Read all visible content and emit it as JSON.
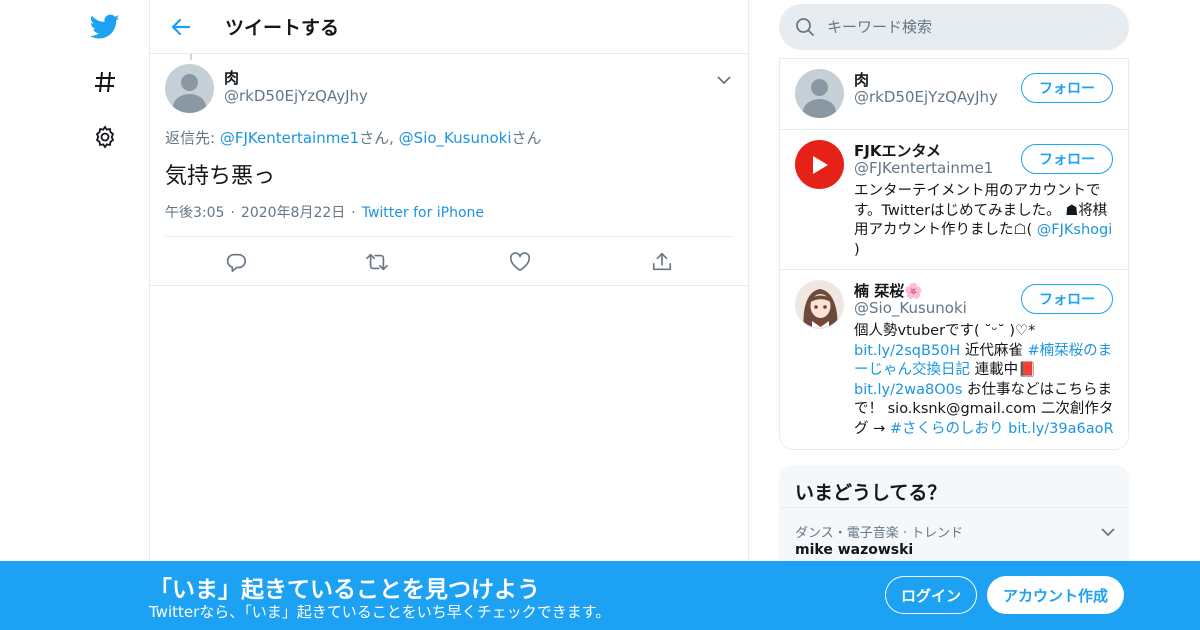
{
  "colors": {
    "accent": "#1da1f2",
    "link": "#1b95e0",
    "muted": "#657786",
    "youtube_red": "#e62117"
  },
  "leftnav": {
    "icons": [
      "twitter-bird-icon",
      "hashtag-icon",
      "gear-icon"
    ]
  },
  "header": {
    "title": "ツイートする"
  },
  "tweet": {
    "author_name": "肉",
    "author_handle": "@rkD50EjYzQAyJhy",
    "reply_label": "返信先: ",
    "reply_user1": "@FJKentertainme1",
    "reply_sep": "さん, ",
    "reply_user2": "@Sio_Kusunoki",
    "reply_suffix": "さん",
    "text": "気持ち悪っ",
    "time": "午後3:05",
    "date": "2020年8月22日",
    "dot": "·",
    "source": "Twitter for iPhone"
  },
  "search": {
    "placeholder": "キーワード検索"
  },
  "who_to_follow": [
    {
      "name": "肉",
      "handle": "@rkD50EjYzQAyJhy",
      "follow_label": "フォロー"
    },
    {
      "name": "FJKエンタメ",
      "handle": "@FJKentertainme1",
      "follow_label": "フォロー",
      "bio_text": "エンターテイメント用のアカウントです。Twitterはじめてみました。 ☗将棋用アカウント作りました☖( ",
      "bio_link": "@FJKshogi",
      "bio_end": " )"
    },
    {
      "name": "楠 栞桜🌸",
      "handle": "@Sio_Kusunoki",
      "follow_label": "フォロー",
      "bio_1": "個人勢vtuberです( ˘ᵕ˘ )♡*",
      "bio_link1": "bit.ly/2sqB50H",
      "bio_2": " 近代麻雀 ",
      "bio_link2": "#楠栞桜のまーじゃん交換日記",
      "bio_3": " 連載中📕",
      "bio_link3": "bit.ly/2wa8O0s",
      "bio_4": " お仕事などはこちらまで！ sio.ksnk@gmail.com 二次創作タグ → ",
      "bio_link4": "#さくらのしおり",
      "bio_5": " ",
      "bio_link5": "bit.ly/39a6aoR"
    }
  ],
  "trends": {
    "title": "いまどうしてる？",
    "items": [
      {
        "context": "ダンス・電子音楽 · トレンド",
        "name": "mike wazowski"
      }
    ]
  },
  "banner": {
    "title": "「いま」起きていることを見つけよう",
    "subtitle": "Twitterなら、「いま」起きていることをいち早くチェックできます。",
    "login_label": "ログイン",
    "signup_label": "アカウント作成"
  }
}
